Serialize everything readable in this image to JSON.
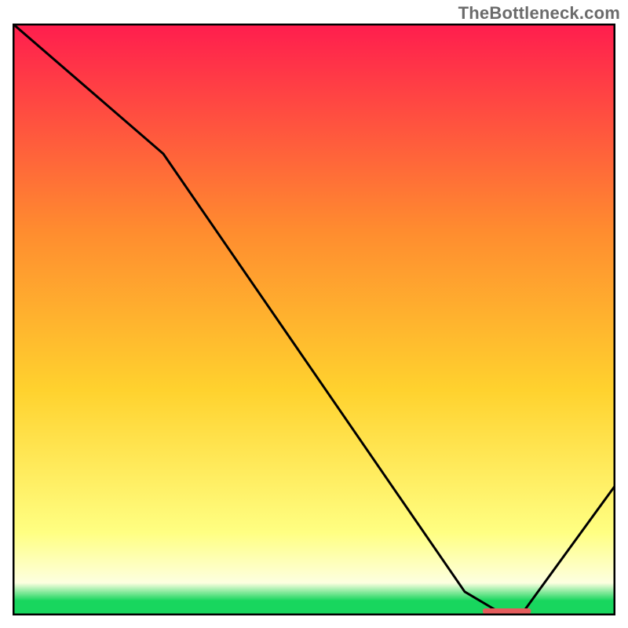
{
  "attribution": "TheBottleneck.com",
  "colors": {
    "frame": "#000000",
    "curve": "#000000",
    "gradient_top": "#ff1d4e",
    "gradient_upper_mid": "#ff8c2f",
    "gradient_mid": "#ffd22e",
    "gradient_lower_mid": "#ffff82",
    "gradient_pale": "#fdffe0",
    "gradient_bottom": "#18d65e",
    "marker": "#e45c5c"
  },
  "chart_data": {
    "type": "line",
    "title": "",
    "xlabel": "",
    "ylabel": "",
    "xlim": [
      0,
      100
    ],
    "ylim": [
      0,
      100
    ],
    "grid": false,
    "legend": false,
    "series": [
      {
        "name": "bottleneck-curve",
        "x": [
          0,
          25,
          75,
          80,
          81,
          82,
          83,
          84,
          85,
          100
        ],
        "values": [
          100,
          78,
          4,
          1,
          0.6,
          0.5,
          0.5,
          0.6,
          1,
          22
        ]
      }
    ],
    "marker": {
      "name": "optimal-range-marker",
      "x_start": 78,
      "x_end": 86,
      "y": 0.8
    }
  }
}
